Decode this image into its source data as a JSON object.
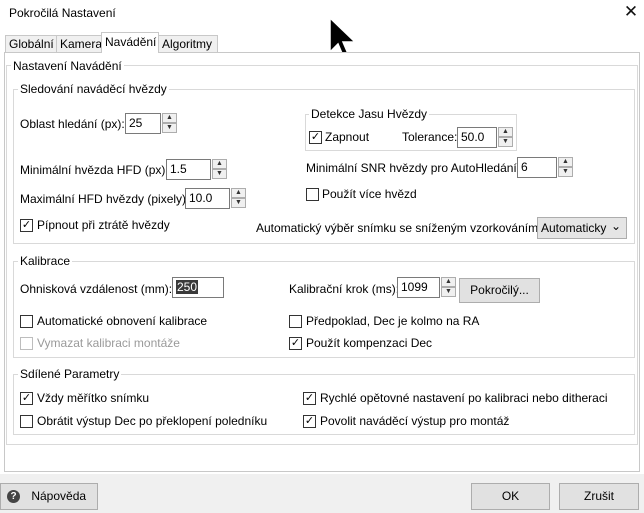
{
  "window": {
    "title": "Pokročilá Nastavení",
    "close_glyph": "✕"
  },
  "tabs": [
    {
      "label": "Globální"
    },
    {
      "label": "Kamera"
    },
    {
      "label": "Navádění"
    },
    {
      "label": "Algoritmy"
    }
  ],
  "panel_title": "Nastavení Navádění",
  "star_tracking": {
    "title": "Sledování naváděcí hvězdy",
    "search_area_label": "Oblast hledání (px):",
    "search_area_value": "25",
    "min_hfd_label": "Minimální hvězda HFD (px):",
    "min_hfd_value": "1.5",
    "max_hfd_label": "Maximální HFD hvězdy (pixely):",
    "max_hfd_value": "10.0",
    "beep_label": "Pípnout při ztrátě hvězdy",
    "beep_checked": true,
    "detection": {
      "title": "Detekce Jasu Hvězdy",
      "enabled_label": "Zapnout",
      "enabled_checked": true,
      "tolerance_label": "Tolerance:",
      "tolerance_value": "50.0"
    },
    "min_snr_label": "Minimální SNR hvězdy pro AutoHledání:",
    "min_snr_value": "6",
    "multi_star_label": "Použít více hvězd",
    "multi_star_checked": false,
    "auto_binning_label": "Automatický výběr snímku se sníženým vzorkováním:",
    "auto_binning_value": "Automaticky"
  },
  "calibration": {
    "title": "Kalibrace",
    "focal_label": "Ohnisková vzdálenost (mm):",
    "focal_value": "250",
    "step_label": "Kalibrační krok (ms):",
    "step_value": "1099",
    "advanced_label": "Pokročilý...",
    "auto_restore_label": "Automatické obnovení kalibrace",
    "auto_restore_checked": false,
    "clear_mount_label": "Vymazat kalibraci montáže",
    "clear_mount_checked": false,
    "assume_dec_label": "Předpoklad, Dec je kolmo na RA",
    "assume_dec_checked": false,
    "dec_comp_label": "Použít kompenzaci Dec",
    "dec_comp_checked": true
  },
  "shared": {
    "title": "Sdílené Parametry",
    "always_scale_label": "Vždy měřítko snímku",
    "always_scale_checked": true,
    "reverse_dec_label": "Obrátit výstup Dec po překlopení poledníku",
    "reverse_dec_checked": false,
    "fast_recenter_label": "Rychlé opětovné nastavení po kalibraci nebo ditheraci",
    "fast_recenter_checked": true,
    "enable_output_label": "Povolit naváděcí výstup pro montáž",
    "enable_output_checked": true
  },
  "footer": {
    "help_label": "Nápověda",
    "ok_label": "OK",
    "cancel_label": "Zrušit"
  },
  "icons": {
    "check": "✓",
    "spin_up": "▲",
    "spin_down": "▼",
    "combo_arrow": "⌄",
    "help": "?"
  }
}
